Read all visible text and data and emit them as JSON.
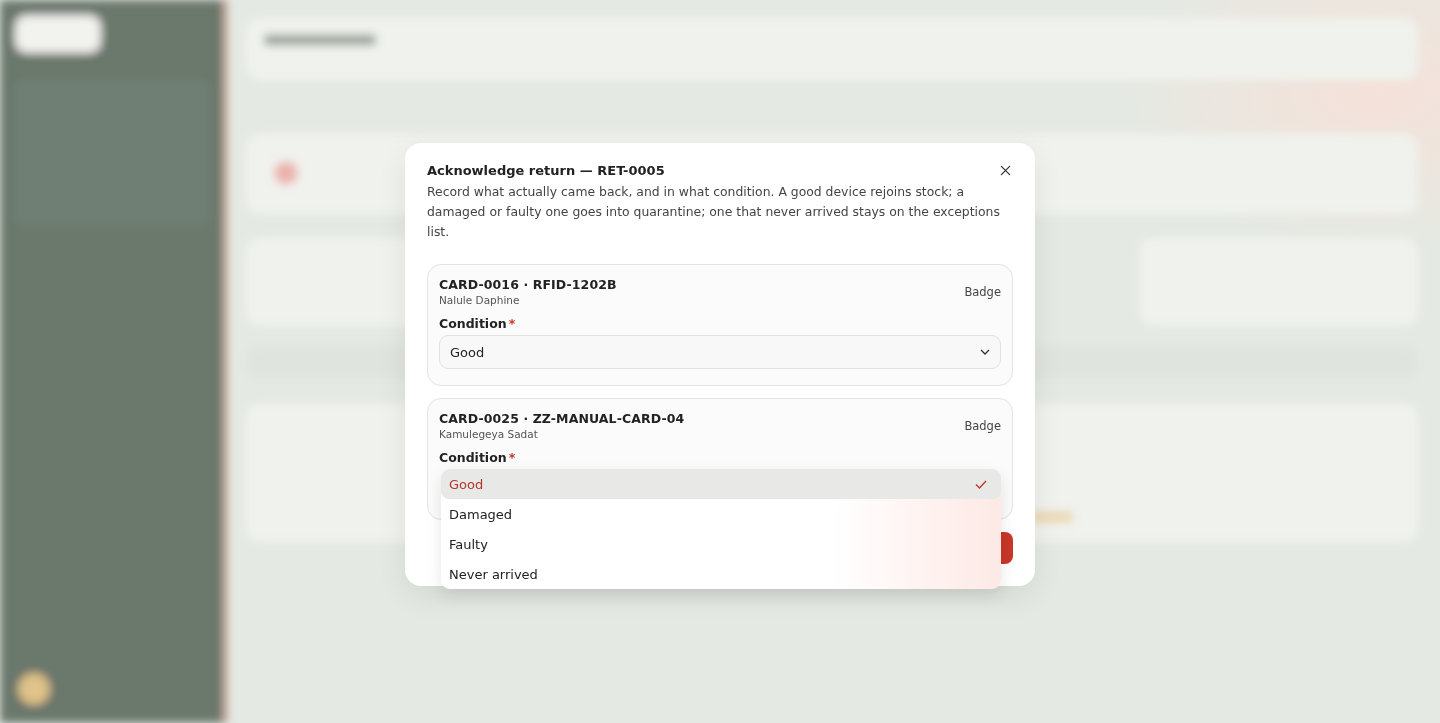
{
  "dialog": {
    "title": "Acknowledge return — RET-0005",
    "description": "Record what actually came back, and in what condition. A good device rejoins stock; a damaged or faulty one goes into quarantine; one that never arrived stays on the exceptions list.",
    "items": [
      {
        "title": "CARD-0016 · RFID-1202B",
        "subtitle": "Nalule Daphine",
        "type": "Badge",
        "label": "Condition",
        "required_mark": "*",
        "value": "Good",
        "open": false
      },
      {
        "title": "CARD-0025 · ZZ-MANUAL-CARD-04",
        "subtitle": "Kamulegeya Sadat",
        "type": "Badge",
        "label": "Condition",
        "required_mark": "*",
        "open": true,
        "options": [
          {
            "label": "Good",
            "selected": true
          },
          {
            "label": "Damaged",
            "selected": false
          },
          {
            "label": "Faulty",
            "selected": false
          },
          {
            "label": "Never arrived",
            "selected": false
          }
        ]
      }
    ]
  }
}
